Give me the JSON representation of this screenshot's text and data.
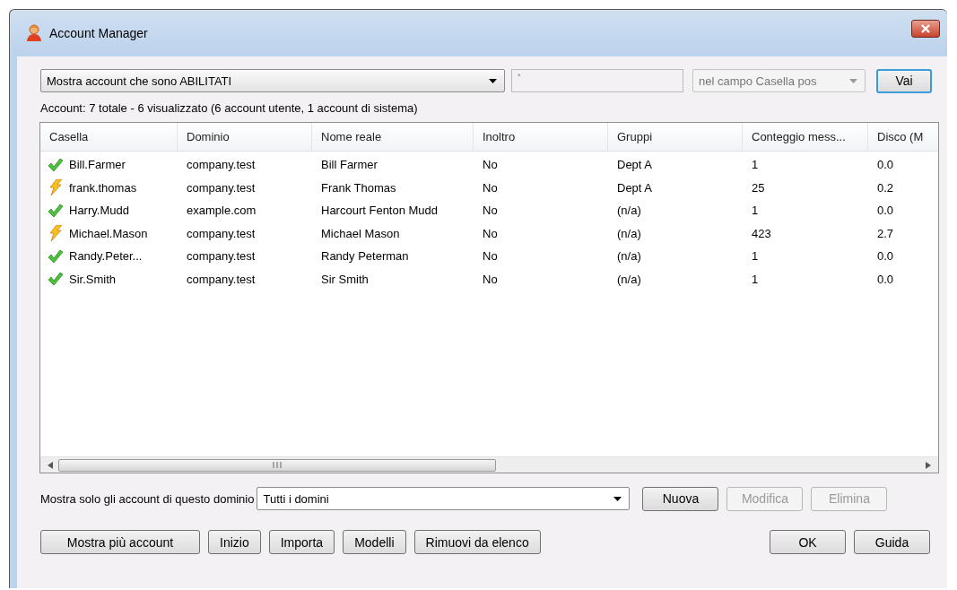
{
  "window": {
    "title": "Account Manager"
  },
  "filter": {
    "show": "Mostra account che sono ABILITATI",
    "search_value": "*",
    "field": "nel campo Casella pos",
    "go_button": "Vai"
  },
  "summary": "Account: 7 totale - 6 visualizzato (6 account utente, 1 account di sistema)",
  "table": {
    "columns": [
      "Casella",
      "Dominio",
      "Nome reale",
      "Inoltro",
      "Gruppi",
      "Conteggio mess...",
      "Disco (M"
    ],
    "rows": [
      {
        "kind": "enabled",
        "cells": [
          "Bill.Farmer",
          "company.test",
          "Bill Farmer",
          "No",
          "Dept A",
          "1",
          "0.0"
        ]
      },
      {
        "kind": "lightning",
        "cells": [
          "frank.thomas",
          "company.test",
          "Frank Thomas",
          "No",
          "Dept A",
          "25",
          "0.2"
        ]
      },
      {
        "kind": "enabled",
        "cells": [
          "Harry.Mudd",
          "example.com",
          "Harcourt Fenton Mudd",
          "No",
          "(n/a)",
          "1",
          "0.0"
        ]
      },
      {
        "kind": "lightning",
        "cells": [
          "Michael.Mason",
          "company.test",
          "Michael Mason",
          "No",
          "(n/a)",
          "423",
          "2.7"
        ]
      },
      {
        "kind": "enabled",
        "cells": [
          "Randy.Peter...",
          "company.test",
          "Randy Peterman",
          "No",
          "(n/a)",
          "1",
          "0.0"
        ]
      },
      {
        "kind": "enabled",
        "cells": [
          "Sir.Smith",
          "company.test",
          "Sir Smith",
          "No",
          "(n/a)",
          "1",
          "0.0"
        ]
      }
    ]
  },
  "domain": {
    "label": "Mostra solo gli account di questo dominio",
    "value": "Tutti i domini"
  },
  "row_buttons": [
    {
      "label": "Nuova",
      "disabled": false
    },
    {
      "label": "Modifica",
      "disabled": true
    },
    {
      "label": "Elimina",
      "disabled": true
    }
  ],
  "bottom_buttons": [
    {
      "label": "Mostra più account",
      "disabled": false
    },
    {
      "label": "Inizio",
      "disabled": false
    },
    {
      "label": "Importa",
      "disabled": false
    },
    {
      "label": "Modelli",
      "disabled": false
    },
    {
      "label": "Rimuovi da elenco",
      "disabled": false
    }
  ],
  "dialog_buttons": [
    {
      "label": "OK",
      "disabled": false
    },
    {
      "label": "Guida",
      "disabled": false
    }
  ]
}
